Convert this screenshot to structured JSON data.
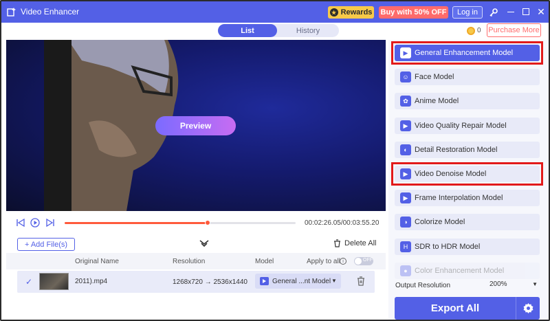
{
  "app": {
    "title": "Video Enhancer",
    "rewards_label": "Rewards",
    "buy_label": "Buy with 50% OFF",
    "login_label": "Log in",
    "coins": "0",
    "purchase_label": "Purchase More"
  },
  "tabs": [
    {
      "label": "List",
      "active": true
    },
    {
      "label": "History",
      "active": false
    }
  ],
  "preview": {
    "button_label": "Preview"
  },
  "playback": {
    "time": "00:02:26.05/00:03:55.20",
    "progress": 0.62
  },
  "file_list": {
    "add_label": "+ Add File(s)",
    "delete_all_label": "Delete All",
    "headers": {
      "name": "Original Name",
      "resolution": "Resolution",
      "model": "Model",
      "apply_all": "Apply to all"
    },
    "toggle_label": "OFF",
    "rows": [
      {
        "name": "2011).mp4",
        "resolution": "1268x720 → 2536x1440",
        "model": "General ...nt Model"
      }
    ]
  },
  "models": [
    {
      "label": "General Enhancement Model",
      "icon": "enhance-icon",
      "active": true,
      "highlighted": true
    },
    {
      "label": "Face Model",
      "icon": "face-icon",
      "active": false,
      "highlighted": false
    },
    {
      "label": "Anime Model",
      "icon": "anime-icon",
      "active": false,
      "highlighted": false
    },
    {
      "label": "Video Quality Repair Model",
      "icon": "repair-icon",
      "active": false,
      "highlighted": false
    },
    {
      "label": "Detail Restoration Model",
      "icon": "detail-icon",
      "active": false,
      "highlighted": false
    },
    {
      "label": "Video Denoise Model",
      "icon": "denoise-icon",
      "active": false,
      "highlighted": true
    },
    {
      "label": "Frame Interpolation Model",
      "icon": "frame-icon",
      "active": false,
      "highlighted": false
    },
    {
      "label": "Colorize Model",
      "icon": "colorize-icon",
      "active": false,
      "highlighted": false
    },
    {
      "label": "SDR to HDR Model",
      "icon": "hdr-icon",
      "active": false,
      "highlighted": false
    },
    {
      "label": "Color Enhancement Model",
      "icon": "color-icon",
      "active": false,
      "highlighted": false
    }
  ],
  "output": {
    "label": "Output Resolution",
    "value": "200%"
  },
  "export": {
    "label": "Export All"
  },
  "colors": {
    "accent": "#5360e6",
    "highlight": "#e21a1a",
    "progress": "#ff5a3c"
  }
}
